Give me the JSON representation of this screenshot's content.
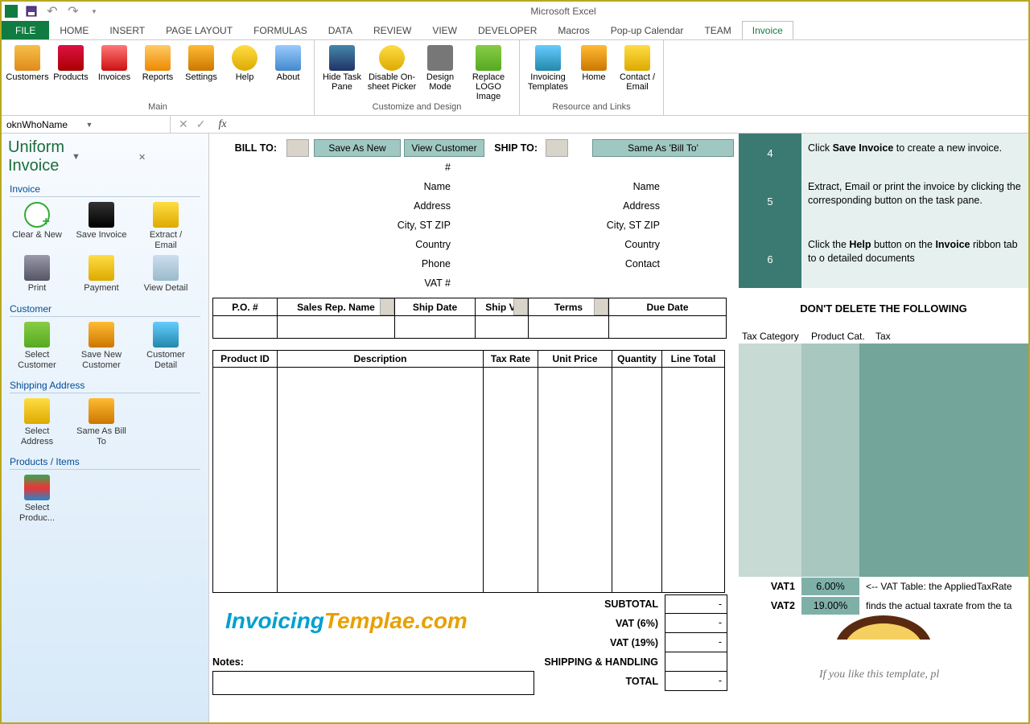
{
  "app_title": "Microsoft Excel",
  "tabs": [
    "FILE",
    "HOME",
    "INSERT",
    "PAGE LAYOUT",
    "FORMULAS",
    "DATA",
    "REVIEW",
    "VIEW",
    "DEVELOPER",
    "Macros",
    "Pop-up Calendar",
    "TEAM",
    "Invoice"
  ],
  "active_tab": "Invoice",
  "ribbon": {
    "groups": [
      {
        "label": "Main",
        "items": [
          "Customers",
          "Products",
          "Invoices",
          "Reports",
          "Settings",
          "Help",
          "About"
        ]
      },
      {
        "label": "Customize and Design",
        "items": [
          "Hide Task Pane",
          "Disable On-sheet Picker",
          "Design Mode",
          "Replace LOGO Image"
        ]
      },
      {
        "label": "Resource and Links",
        "items": [
          "Invoicing Templates",
          "Home",
          "Contact / Email"
        ]
      }
    ]
  },
  "namebox": "oknWhoName",
  "taskpane": {
    "title": "Uniform Invoice",
    "sections": [
      {
        "heading": "Invoice",
        "items": [
          "Clear & New",
          "Save Invoice",
          "Extract / Email",
          "Print",
          "Payment",
          "View Detail"
        ]
      },
      {
        "heading": "Customer",
        "items": [
          "Select Customer",
          "Save New Customer",
          "Customer Detail"
        ]
      },
      {
        "heading": "Shipping Address",
        "items": [
          "Select Address",
          "Same As Bill To"
        ]
      },
      {
        "heading": "Products / Items",
        "items": [
          "Select Produc..."
        ]
      }
    ]
  },
  "sheet": {
    "billto": {
      "label": "BILL TO:",
      "buttons": [
        "Save As New",
        "View Customer"
      ],
      "fields": [
        "#",
        "Name",
        "Address",
        "City, ST ZIP",
        "Country",
        "Phone",
        "VAT #"
      ]
    },
    "shipto": {
      "label": "SHIP TO:",
      "button": "Same As 'Bill To'",
      "fields": [
        "Name",
        "Address",
        "City, ST ZIP",
        "Country",
        "Contact"
      ]
    },
    "order_headers": [
      "P.O. #",
      "Sales Rep. Name",
      "Ship Date",
      "Ship Vi",
      "Terms",
      "Due Date"
    ],
    "item_headers": [
      "Product ID",
      "Description",
      "Tax Rate",
      "Unit Price",
      "Quantity",
      "Line Total"
    ],
    "totals": [
      {
        "label": "SUBTOTAL",
        "value": "-"
      },
      {
        "label": "VAT (6%)",
        "value": "-"
      },
      {
        "label": "VAT (19%)",
        "value": "-"
      },
      {
        "label": "SHIPPING & HANDLING",
        "value": ""
      },
      {
        "label": "TOTAL",
        "value": "-"
      }
    ],
    "watermark_a": "Invoicing",
    "watermark_b": "Templae.com",
    "notes_label": "Notes:"
  },
  "hints": {
    "rows": [
      {
        "num": "4",
        "html": "Click <b>Save Invoice</b> to create a new invoice."
      },
      {
        "num": "5",
        "html": "Extract, Email or print the invoice by clicking the corresponding button on the task pane."
      },
      {
        "num": "6",
        "html": "Click the <b>Help</b> button on the <b>Invoice</b> ribbon tab to o detailed documents"
      }
    ],
    "warn": "DON'T DELETE THE FOLLOWING",
    "cat_headers": [
      "Tax Category",
      "Product Cat.",
      "Tax"
    ],
    "vat": [
      {
        "l": "VAT1",
        "m": "6.00%",
        "r": "<-- VAT Table: the AppliedTaxRate"
      },
      {
        "l": "VAT2",
        "m": "19.00%",
        "r": "finds the actual taxrate from the ta"
      }
    ],
    "like": "If you like this template, pl"
  }
}
